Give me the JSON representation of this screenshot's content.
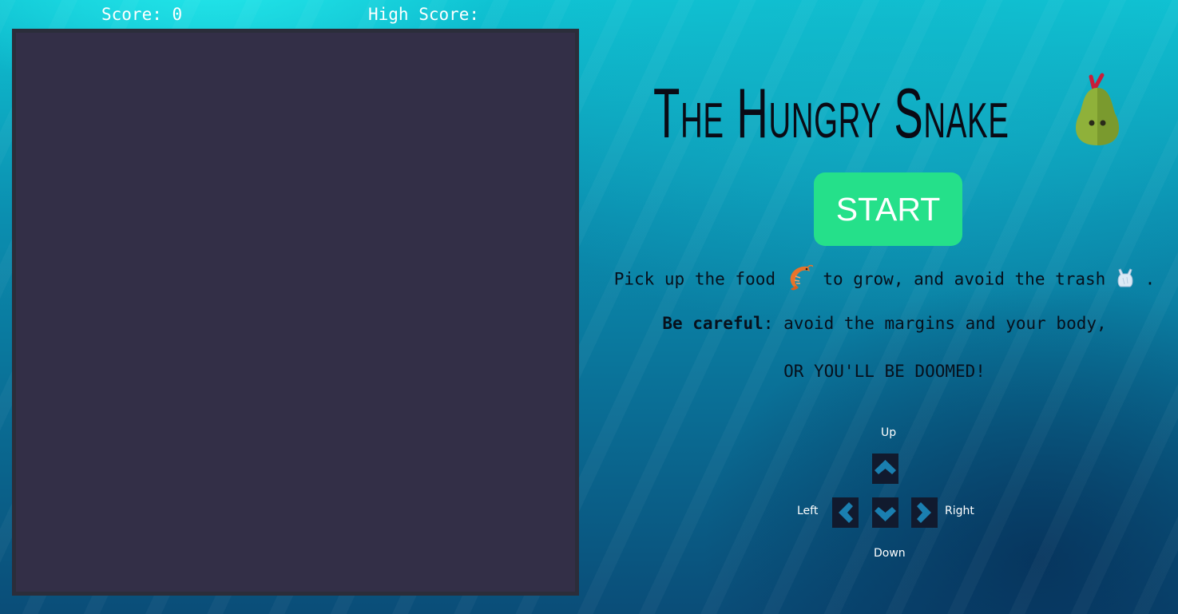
{
  "header": {
    "score_text": "Score: 0",
    "high_score_text": "High Score:"
  },
  "panel": {
    "title": "The Hungry Snake",
    "title_icon": "pear-icon",
    "start_label": "START",
    "instruction_1_a": "Pick up the food",
    "instruction_1_food_icon": "shrimp-icon",
    "instruction_1_b": "to grow, and avoid the trash",
    "instruction_1_trash_icon": "plastic-bag-icon",
    "instruction_1_c": ".",
    "instruction_2_bold": "Be careful",
    "instruction_2_rest": ": avoid the margins and your body,",
    "instruction_3": "OR YOU'LL BE DOOMED!"
  },
  "controls": {
    "up_label": "Up",
    "left_label": "Left",
    "right_label": "Right",
    "down_label": "Down"
  },
  "colors": {
    "board": "#332f47",
    "board_border": "#2b2d3a",
    "start_button": "#25e08a",
    "key_bg": "#111a2e",
    "key_arrow": "#1a7fb0"
  }
}
